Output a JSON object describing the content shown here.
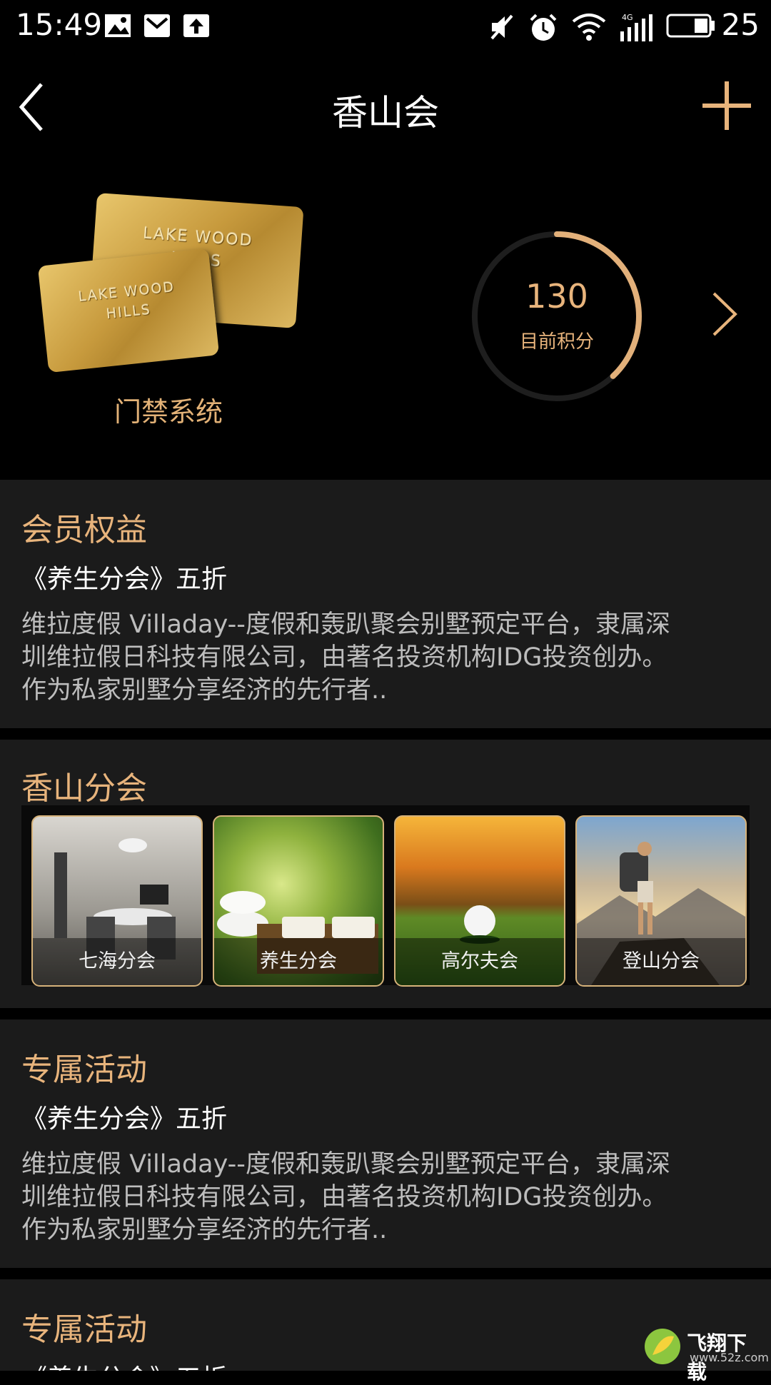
{
  "status_bar": {
    "time": "15:49",
    "battery": "25"
  },
  "header": {
    "title": "香山会"
  },
  "hero": {
    "card_text_back": "LAKE WOOD",
    "card_text_back_2": "HILLS",
    "card_text_front": "LAKE WOOD",
    "card_text_front_2": "HILLS",
    "access_label": "门禁系统",
    "points_value": "130",
    "points_label": "目前积分",
    "points_ring_fraction": 0.38
  },
  "benefits": {
    "title": "会员权益",
    "subtitle": "《养生分会》五折",
    "desc_line1": "维拉度假 Villaday--度假和轰趴聚会别墅预定平台，隶属深",
    "desc_line2": "圳维拉假日科技有限公司，由著名投资机构IDG投资创办。",
    "desc_line3": "作为私家别墅分享经济的先行者.."
  },
  "branches": {
    "title": "香山分会",
    "items": [
      {
        "label": "七海分会"
      },
      {
        "label": "养生分会"
      },
      {
        "label": "高尔夫会"
      },
      {
        "label": "登山分会"
      }
    ]
  },
  "activities": {
    "title": "专属活动",
    "subtitle": "《养生分会》五折",
    "desc_line1": "维拉度假 Villaday--度假和轰趴聚会别墅预定平台，隶属深",
    "desc_line2": "圳维拉假日科技有限公司，由著名投资机构IDG投资创办。",
    "desc_line3": "作为私家别墅分享经济的先行者.."
  },
  "activities2": {
    "title": "专属活动",
    "subtitle": "《养生分会》五折"
  },
  "watermark": {
    "text": "飞翔下载",
    "sub": "www.52z.com"
  },
  "colors": {
    "accent": "#e8b47c",
    "section_bg": "#1b1b1b",
    "background": "#000000"
  }
}
